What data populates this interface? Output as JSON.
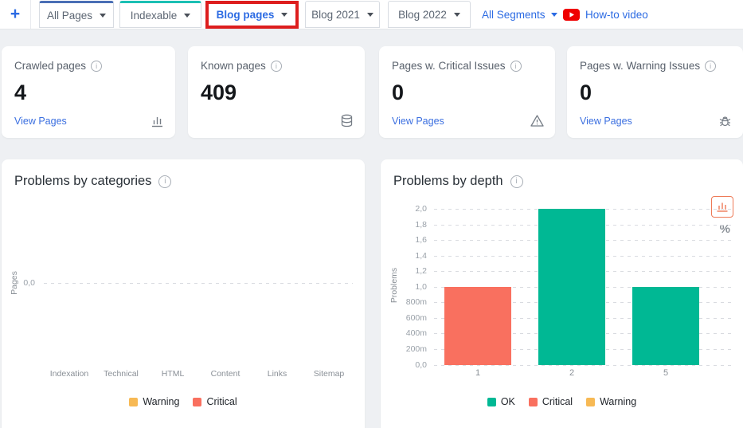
{
  "topbar": {
    "add_label": "+",
    "tabs": [
      {
        "label": "All Pages",
        "accent": "#4a6fb5"
      },
      {
        "label": "Indexable",
        "accent": "#1cc0b4"
      },
      {
        "label": "Blog pages",
        "active": true,
        "annotated": true
      },
      {
        "label": "Blog 2021"
      },
      {
        "label": "Blog 2022"
      }
    ],
    "segments_label": "All Segments",
    "howto_label": "How-to video"
  },
  "cards": [
    {
      "title": "Crawled pages",
      "value": "4",
      "link": "View Pages",
      "icon": "bar-chart-icon"
    },
    {
      "title": "Known pages",
      "value": "409",
      "link": "",
      "icon": "database-icon"
    },
    {
      "title": "Pages w. Critical Issues",
      "value": "0",
      "link": "View Pages",
      "icon": "warning-triangle-icon"
    },
    {
      "title": "Pages w. Warning Issues",
      "value": "0",
      "link": "View Pages",
      "icon": "bug-icon"
    }
  ],
  "chart_toggles": {
    "percent_label": "%"
  },
  "colors": {
    "accent_blue": "#2c6be3",
    "all_pages_tab_accent": "#4a6fb5",
    "indexable_tab_accent": "#1cc0b4",
    "annotation_red": "#dd1d1d",
    "youtube_red": "#ef0000",
    "ok_green": "#00b894",
    "critical_coral": "#f9705f",
    "warning_yellow": "#f7b954"
  },
  "chart_data": [
    {
      "type": "bar",
      "title": "Problems by categories",
      "categories": [
        "Indexation",
        "Technical",
        "HTML",
        "Content",
        "Links",
        "Sitemap"
      ],
      "series": [
        {
          "name": "Warning",
          "color": "#f7b954",
          "values": [
            0,
            0,
            0,
            0,
            0,
            0
          ]
        },
        {
          "name": "Critical",
          "color": "#f9705f",
          "values": [
            0,
            0,
            0,
            0,
            0,
            0
          ]
        }
      ],
      "xlabel": "",
      "ylabel": "Pages",
      "ylim": [
        0,
        0
      ],
      "yticks": [
        "0,0"
      ],
      "grid": "dashed",
      "legend": [
        {
          "label": "Warning",
          "color": "#f7b954"
        },
        {
          "label": "Critical",
          "color": "#f9705f"
        }
      ],
      "legend_position": "bottom"
    },
    {
      "type": "bar",
      "title": "Problems by depth",
      "categories": [
        "1",
        "2",
        "5"
      ],
      "values": [
        1,
        2,
        1
      ],
      "bar_status": [
        "Critical",
        "OK",
        "OK"
      ],
      "bar_colors": [
        "#f9705f",
        "#00b894",
        "#00b894"
      ],
      "xlabel": "",
      "ylabel": "Problems",
      "ylim": [
        0,
        2
      ],
      "yticks": [
        "2,0",
        "1,8",
        "1,6",
        "1,4",
        "1,2",
        "1,0",
        "800m",
        "600m",
        "400m",
        "200m",
        "0,0"
      ],
      "grid": "dashed",
      "legend": [
        {
          "label": "OK",
          "color": "#00b894"
        },
        {
          "label": "Critical",
          "color": "#f9705f"
        },
        {
          "label": "Warning",
          "color": "#f7b954"
        }
      ],
      "legend_position": "bottom"
    }
  ]
}
